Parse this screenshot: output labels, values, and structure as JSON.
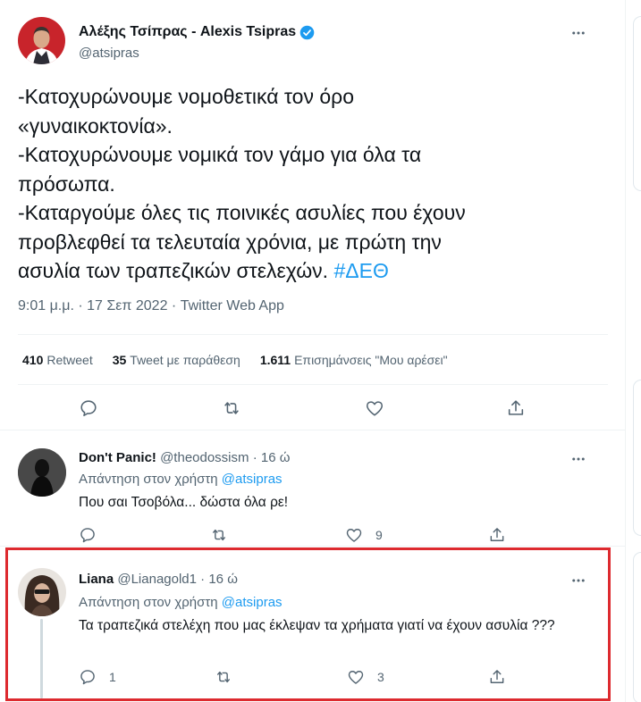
{
  "main_tweet": {
    "author_name": "Αλέξης Τσίπρας - Alexis Tsipras",
    "handle": "@atsipras",
    "text_plain": "-Κατοχυρώνουμε νομοθετικά τον όρο\n«γυναικοκτονία».\n-Κατοχυρώνουμε νομικά τον γάμο για όλα τα\nπρόσωπα.\n-Καταργούμε όλες τις ποινικές ασυλίες που έχουν\nπροβλεφθεί τα τελευταία χρόνια, με πρώτη την\nασυλία των τραπεζικών στελεχών. ",
    "hashtag": "#ΔΕΘ",
    "meta": "9:01 μ.μ. · 17 Σεπ 2022 · Twitter Web App",
    "stats": [
      {
        "num": "410",
        "label": "Retweet"
      },
      {
        "num": "35",
        "label": "Tweet με παράθεση"
      },
      {
        "num": "1.611",
        "label": "Επισημάνσεις \"Μου αρέσει\""
      }
    ]
  },
  "replies": [
    {
      "name": "Don't Panic!",
      "handle": "@theodossism",
      "time": "16 ώ",
      "replying_prefix": "Απάντηση στον χρήστη ",
      "replying_to": "@atsipras",
      "text": "Που σαι Τσοβόλα... δώστα όλα ρε!",
      "reply_count": "",
      "retweet_count": "",
      "like_count": "9"
    },
    {
      "name": "Liana",
      "handle": "@Lianagold1",
      "time": "16 ώ",
      "replying_prefix": "Απάντηση στον χρήστη ",
      "replying_to": "@atsipras",
      "text": "Τα τραπεζικά στελέχη που μας έκλεψαν τα χρήματα γιατί να έχουν ασυλία ???",
      "reply_count": "1",
      "retweet_count": "",
      "like_count": "3"
    }
  ],
  "icons": {
    "reply": "reply-icon",
    "retweet": "retweet-icon",
    "like": "heart-icon",
    "share": "share-icon",
    "more": "more-icon",
    "verified": "verified-badge-icon"
  },
  "colors": {
    "accent": "#1d9bf0",
    "muted": "#536471",
    "text": "#0f1419",
    "highlight": "#dd2a2f"
  }
}
